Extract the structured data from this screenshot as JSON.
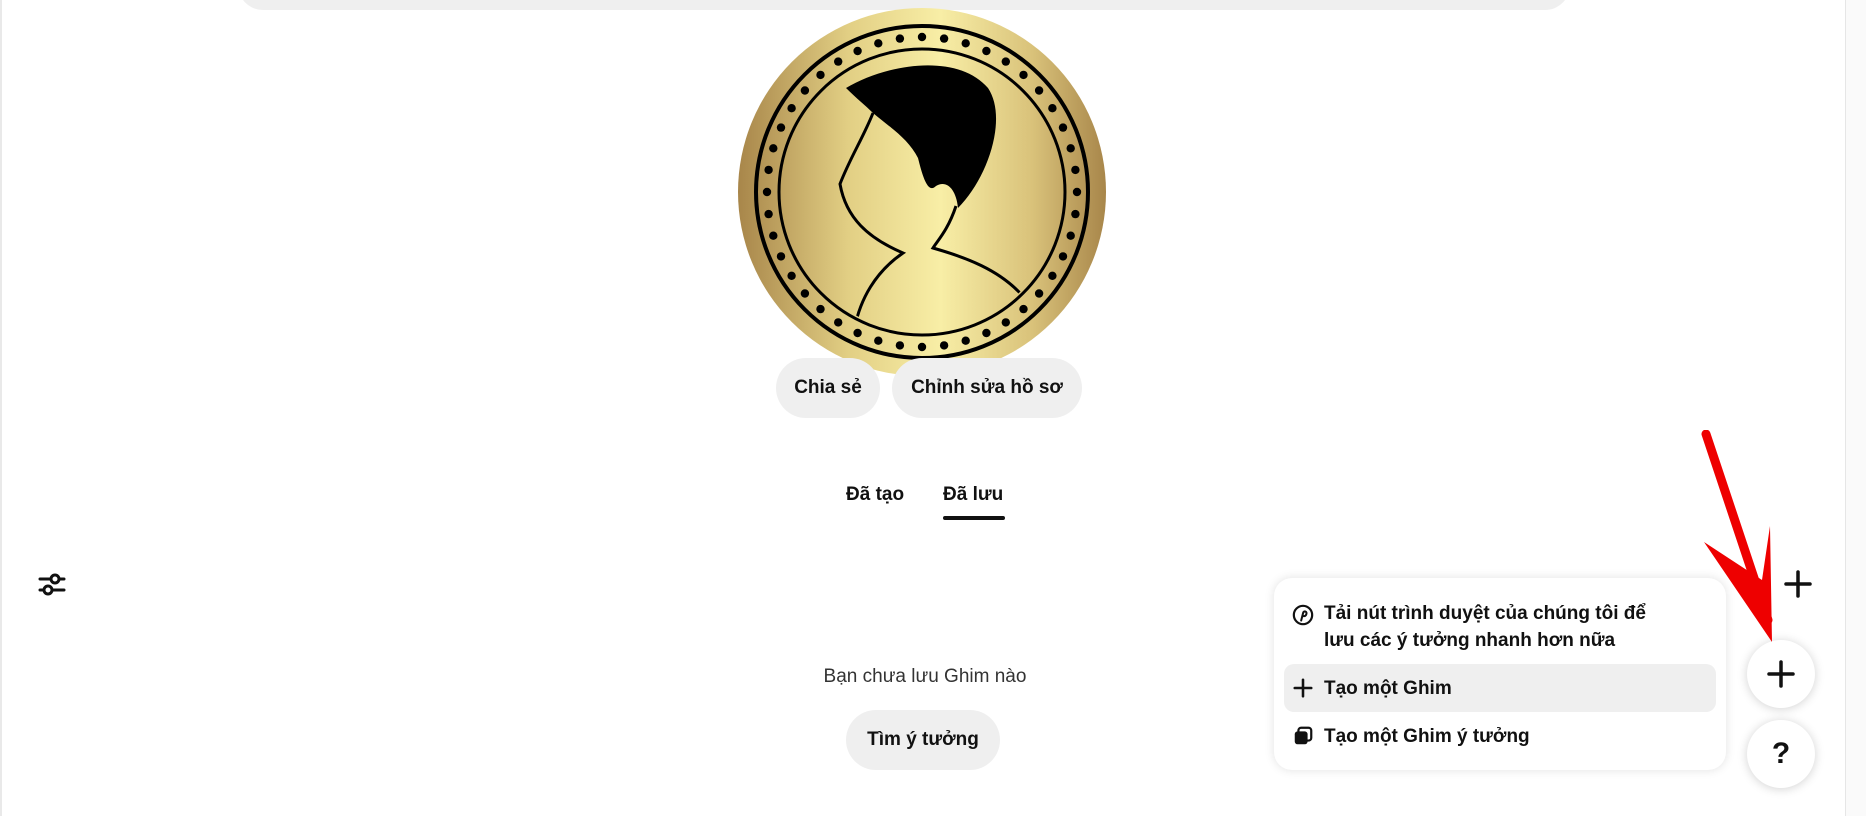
{
  "profile": {
    "share_label": "Chia sẻ",
    "edit_label": "Chỉnh sửa hồ sơ"
  },
  "tabs": [
    {
      "label": "Đã tạo",
      "active": false
    },
    {
      "label": "Đã lưu",
      "active": true
    }
  ],
  "empty_state": {
    "message": "Bạn chưa lưu Ghim nào",
    "button_label": "Tìm ý tưởng"
  },
  "create_menu": {
    "items": [
      {
        "label_line1": "Tải nút trình duyệt của chúng tôi để",
        "label_line2": "lưu các ý tưởng nhanh hơn nữa",
        "icon": "pinterest-icon"
      },
      {
        "label": "Tạo một Ghim",
        "icon": "plus-icon"
      },
      {
        "label": "Tạo một Ghim ý tưởng",
        "icon": "idea-pin-icon"
      }
    ]
  },
  "help_button": {
    "label": "?"
  },
  "colors": {
    "pill_bg": "#efefef",
    "text": "#111111",
    "coin_gold": "#f7eba0",
    "arrow": "#ee0000"
  }
}
